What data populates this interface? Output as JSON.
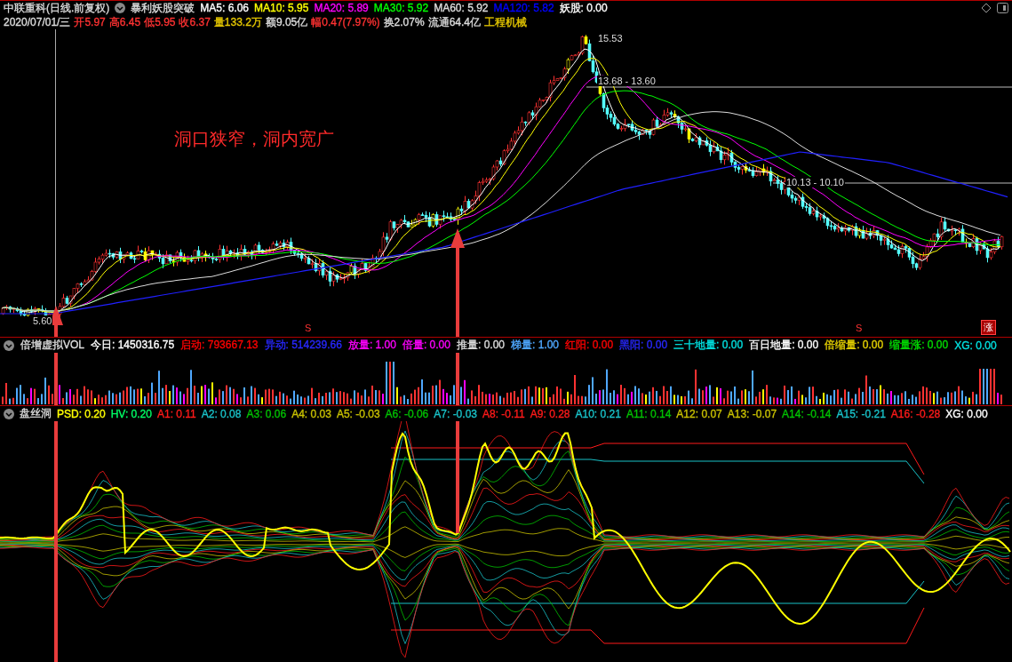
{
  "header": {
    "title": "中联重科(日线.前复权)",
    "indicator": "暴利妖股突破",
    "ma_values": [
      {
        "text": "MA5: 6.06",
        "color": "#ffffff"
      },
      {
        "text": "MA10: 5.95",
        "color": "#ffff00"
      },
      {
        "text": "MA20: 5.89",
        "color": "#ff00ff"
      },
      {
        "text": "MA30: 5.92",
        "color": "#00ff00"
      },
      {
        "text": "MA60: 5.92",
        "color": "#dddddd"
      },
      {
        "text": "MA120: 5.82",
        "color": "#0000ff"
      },
      {
        "text": "妖股: 0.00",
        "color": "#ffffff"
      }
    ]
  },
  "quote": {
    "date": "2020/07/01/三",
    "items": [
      {
        "text": "开5.97",
        "color": "#ff3232"
      },
      {
        "text": "高6.45",
        "color": "#ff3232"
      },
      {
        "text": "低5.95",
        "color": "#ff3232"
      },
      {
        "text": "收6.37",
        "color": "#ff3232"
      },
      {
        "text": "量133.2万",
        "color": "#e6c800"
      },
      {
        "text": "额9.05亿",
        "color": "#dddddd"
      },
      {
        "text": "幅0.47(7.97%)",
        "color": "#ff3232"
      },
      {
        "text": "换2.07%",
        "color": "#dddddd"
      },
      {
        "text": "流通64.4亿",
        "color": "#dddddd"
      },
      {
        "text": "工程机械",
        "color": "#e6c800"
      }
    ]
  },
  "price_chart": {
    "caption": "洞口狭窄，洞内宽广",
    "labels": [
      {
        "text": "15.53"
      },
      {
        "text": "13.68 - 13.60"
      },
      {
        "text": "10.13 - 10.10"
      },
      {
        "text": "5.60"
      }
    ],
    "signals": [
      {
        "text": "S"
      },
      {
        "text": "S"
      }
    ],
    "badge": "涨"
  },
  "volume_panel": {
    "name": "倍增虚拟VOL",
    "values": [
      {
        "text": "今日: 1450316.75",
        "color": "#ffffff"
      },
      {
        "text": "启动: 793667.13",
        "color": "#ff0000"
      },
      {
        "text": "异动: 514239.66",
        "color": "#2828ff"
      },
      {
        "text": "放量: 1.00",
        "color": "#ff00ff"
      },
      {
        "text": "倍量: 0.00",
        "color": "#ff00ff"
      },
      {
        "text": "推量: 0.00",
        "color": "#dddddd"
      },
      {
        "text": "梯量: 1.00",
        "color": "#4fa8ff"
      },
      {
        "text": "红阳: 0.00",
        "color": "#ff0000"
      },
      {
        "text": "黑阳: 0.00",
        "color": "#2828ff"
      },
      {
        "text": "三十地量: 0.00",
        "color": "#00e0e0"
      },
      {
        "text": "百日地量: 0.00",
        "color": "#ffffff"
      },
      {
        "text": "倍缩量: 0.00",
        "color": "#e6d200"
      },
      {
        "text": "缩量涨: 0.00",
        "color": "#00dd00"
      },
      {
        "text": "XG: 0.00",
        "color": "#00e0e0"
      }
    ]
  },
  "psd_panel": {
    "name": "盘丝洞",
    "values": [
      {
        "text": "PSD: 0.20",
        "color": "#ffff00"
      },
      {
        "text": "HV: 0.20",
        "color": "#00ff66"
      },
      {
        "text": "A1: 0.11",
        "color": "#ff1a1a"
      },
      {
        "text": "A2: 0.08",
        "color": "#19c2c8"
      },
      {
        "text": "A3: 0.06",
        "color": "#00c000"
      },
      {
        "text": "A4: 0.03",
        "color": "#c8c000"
      },
      {
        "text": "A5: -0.03",
        "color": "#c8c000"
      },
      {
        "text": "A6: -0.06",
        "color": "#00c000"
      },
      {
        "text": "A7: -0.03",
        "color": "#19c2c8"
      },
      {
        "text": "A8: -0.11",
        "color": "#ff1a1a"
      },
      {
        "text": "A9: 0.28",
        "color": "#ff1a1a"
      },
      {
        "text": "A10: 0.21",
        "color": "#19c2c8"
      },
      {
        "text": "A11: 0.14",
        "color": "#00c000"
      },
      {
        "text": "A12: 0.07",
        "color": "#c8c000"
      },
      {
        "text": "A13: -0.07",
        "color": "#c8c000"
      },
      {
        "text": "A14: -0.14",
        "color": "#00c000"
      },
      {
        "text": "A15: -0.21",
        "color": "#19c2c8"
      },
      {
        "text": "A16: -0.28",
        "color": "#ff1a1a"
      },
      {
        "text": "XG: 0.00",
        "color": "#ffffff"
      }
    ]
  }
}
